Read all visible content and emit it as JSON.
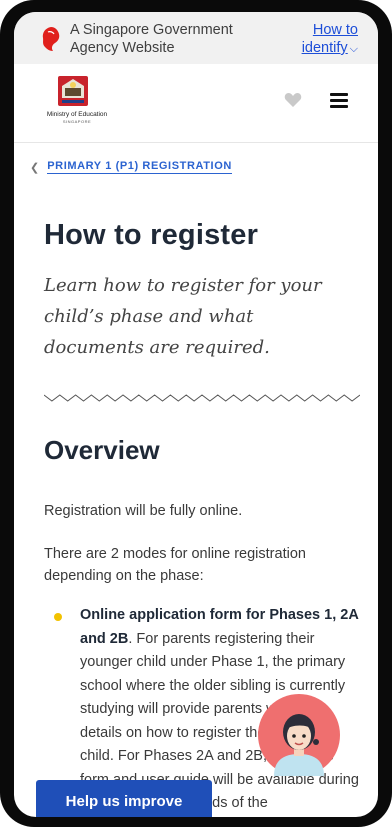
{
  "masthead": {
    "text": "A Singapore Government Agency Website",
    "identify_line1": "How to",
    "identify_line2": "identify"
  },
  "header": {
    "org_name": "Ministry of Education",
    "org_sub": "SINGAPORE"
  },
  "breadcrumb": {
    "label": "PRIMARY 1 (P1) REGISTRATION"
  },
  "page": {
    "title": "How to register",
    "lead": "Learn how to register for your child’s phase and what documents are required."
  },
  "overview": {
    "heading": "Overview",
    "para1": "Registration will be fully online.",
    "para2": "There are 2 modes for online registration depending on the phase:",
    "bullet_bold": "Online application form for Phases 1, 2A and 2B",
    "bullet_text": ". For parents registering their younger child under Phase 1, the primary school where the older sibling is currently studying will provide parents with more details on how to register their younger child. For Phases 2A and 2B, the online form and user guide will be available during the registration periods of the"
  },
  "feedback": {
    "label": "Help us improve"
  },
  "colors": {
    "accent": "#2b63d0",
    "bullet": "#f2c200",
    "help_button": "#1f4fb8",
    "masthead_bg": "#f1f1f1"
  }
}
